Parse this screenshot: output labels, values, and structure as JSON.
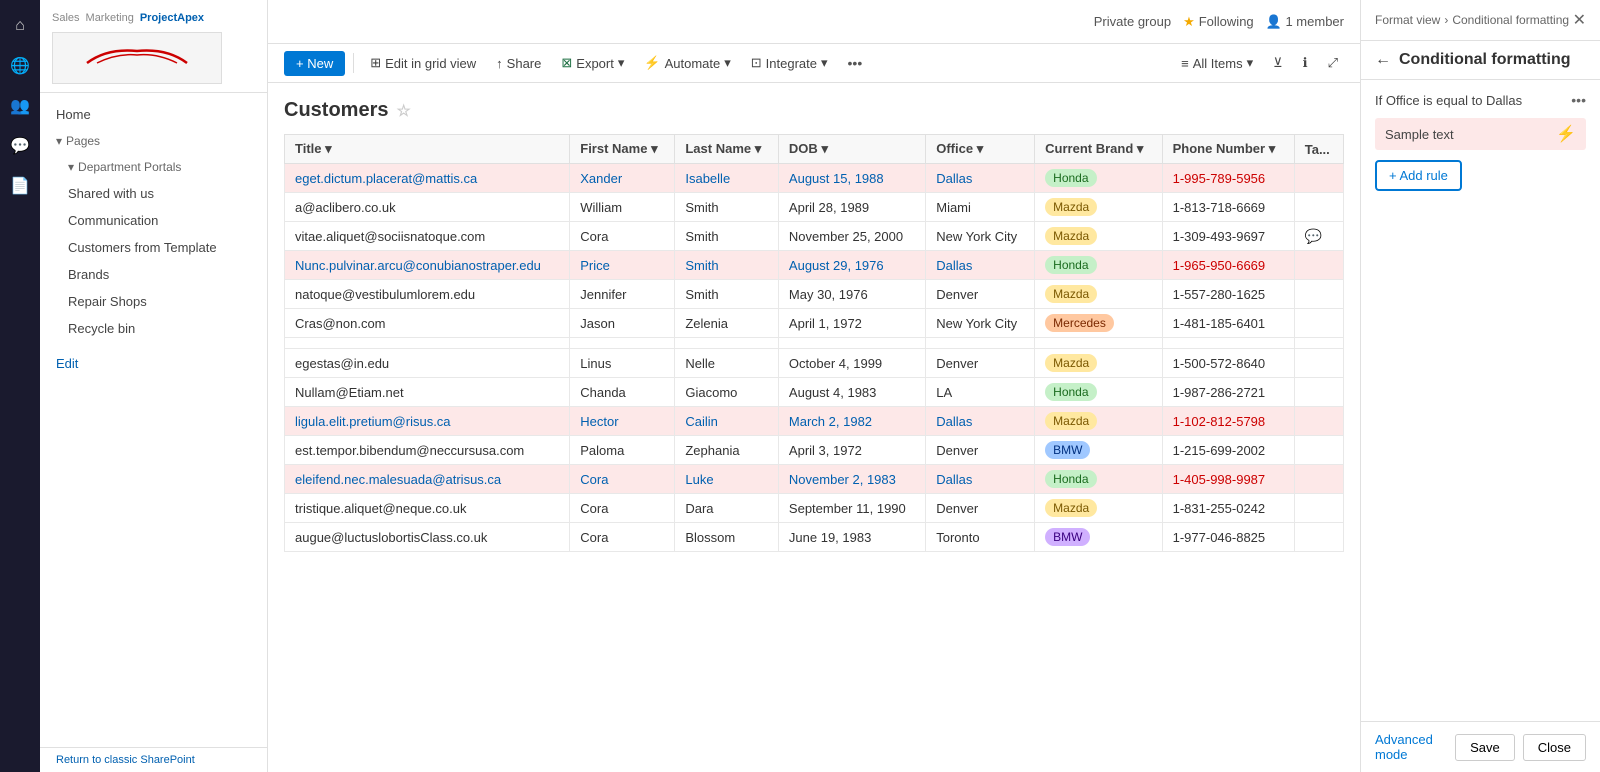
{
  "app": {
    "title": "ProjectApex",
    "nav_tabs": [
      "Sales",
      "Marketing",
      "ProjectApex"
    ]
  },
  "sidebar_icons": [
    {
      "name": "home-icon",
      "symbol": "⌂"
    },
    {
      "name": "globe-icon",
      "symbol": "🌐"
    },
    {
      "name": "people-icon",
      "symbol": "👥"
    },
    {
      "name": "chat-icon",
      "symbol": "💬"
    },
    {
      "name": "document-icon",
      "symbol": "📄"
    }
  ],
  "nav": {
    "home_label": "Home",
    "pages_label": "Pages",
    "department_portals_label": "Department Portals",
    "items": [
      {
        "label": "Shared with us",
        "id": "shared"
      },
      {
        "label": "Communication",
        "id": "communication"
      },
      {
        "label": "Customers from Template",
        "id": "customers-template"
      },
      {
        "label": "Brands",
        "id": "brands"
      },
      {
        "label": "Repair Shops",
        "id": "repair-shops"
      },
      {
        "label": "Recycle bin",
        "id": "recycle-bin"
      }
    ],
    "edit_label": "Edit",
    "return_label": "Return to classic SharePoint"
  },
  "top_bar": {
    "private_group_label": "Private group",
    "following_label": "Following",
    "member_label": "1 member"
  },
  "toolbar": {
    "new_label": "+ New",
    "edit_grid_label": "Edit in grid view",
    "share_label": "Share",
    "export_label": "Export",
    "automate_label": "Automate",
    "integrate_label": "Integrate",
    "all_items_label": "All Items"
  },
  "table": {
    "title": "Customers",
    "columns": [
      "Title",
      "First Name",
      "Last Name",
      "DOB",
      "Office",
      "Current Brand",
      "Phone Number",
      "Ta..."
    ],
    "rows": [
      {
        "title": "eget.dictum.placerat@mattis.ca",
        "first_name": "Xander",
        "last_name": "Isabelle",
        "dob": "August 15, 1988",
        "office": "Dallas",
        "brand": "Honda",
        "brand_class": "brand-honda",
        "phone": "1-995-789-5956",
        "highlight": true,
        "chat": false
      },
      {
        "title": "a@aclibero.co.uk",
        "first_name": "William",
        "last_name": "Smith",
        "dob": "April 28, 1989",
        "office": "Miami",
        "brand": "Mazda",
        "brand_class": "brand-mazda",
        "phone": "1-813-718-6669",
        "highlight": false,
        "chat": false
      },
      {
        "title": "vitae.aliquet@sociisnatoque.com",
        "first_name": "Cora",
        "last_name": "Smith",
        "dob": "November 25, 2000",
        "office": "New York City",
        "brand": "Mazda",
        "brand_class": "brand-mazda",
        "phone": "1-309-493-9697",
        "highlight": false,
        "chat": true
      },
      {
        "title": "Nunc.pulvinar.arcu@conubianostraper.edu",
        "first_name": "Price",
        "last_name": "Smith",
        "dob": "August 29, 1976",
        "office": "Dallas",
        "brand": "Honda",
        "brand_class": "brand-honda",
        "phone": "1-965-950-6669",
        "highlight": true,
        "chat": false
      },
      {
        "title": "natoque@vestibulumlorem.edu",
        "first_name": "Jennifer",
        "last_name": "Smith",
        "dob": "May 30, 1976",
        "office": "Denver",
        "brand": "Mazda",
        "brand_class": "brand-mazda",
        "phone": "1-557-280-1625",
        "highlight": false,
        "chat": false
      },
      {
        "title": "Cras@non.com",
        "first_name": "Jason",
        "last_name": "Zelenia",
        "dob": "April 1, 1972",
        "office": "New York City",
        "brand": "Mercedes",
        "brand_class": "brand-mercedes",
        "phone": "1-481-185-6401",
        "highlight": false,
        "chat": false
      },
      {
        "title": "",
        "first_name": "",
        "last_name": "",
        "dob": "",
        "office": "",
        "brand": "",
        "brand_class": "",
        "phone": "",
        "highlight": false,
        "chat": false
      },
      {
        "title": "egestas@in.edu",
        "first_name": "Linus",
        "last_name": "Nelle",
        "dob": "October 4, 1999",
        "office": "Denver",
        "brand": "Mazda",
        "brand_class": "brand-mazda",
        "phone": "1-500-572-8640",
        "highlight": false,
        "chat": false
      },
      {
        "title": "Nullam@Etiam.net",
        "first_name": "Chanda",
        "last_name": "Giacomo",
        "dob": "August 4, 1983",
        "office": "LA",
        "brand": "Honda",
        "brand_class": "brand-honda",
        "phone": "1-987-286-2721",
        "highlight": false,
        "chat": false
      },
      {
        "title": "ligula.elit.pretium@risus.ca",
        "first_name": "Hector",
        "last_name": "Cailin",
        "dob": "March 2, 1982",
        "office": "Dallas",
        "brand": "Mazda",
        "brand_class": "brand-mazda",
        "phone": "1-102-812-5798",
        "highlight": true,
        "chat": false
      },
      {
        "title": "est.tempor.bibendum@neccursusa.com",
        "first_name": "Paloma",
        "last_name": "Zephania",
        "dob": "April 3, 1972",
        "office": "Denver",
        "brand": "BMW",
        "brand_class": "brand-bmw",
        "phone": "1-215-699-2002",
        "highlight": false,
        "chat": false
      },
      {
        "title": "eleifend.nec.malesuada@atrisus.ca",
        "first_name": "Cora",
        "last_name": "Luke",
        "dob": "November 2, 1983",
        "office": "Dallas",
        "brand": "Honda",
        "brand_class": "brand-honda",
        "phone": "1-405-998-9987",
        "highlight": true,
        "chat": false
      },
      {
        "title": "tristique.aliquet@neque.co.uk",
        "first_name": "Cora",
        "last_name": "Dara",
        "dob": "September 11, 1990",
        "office": "Denver",
        "brand": "Mazda",
        "brand_class": "brand-mazda",
        "phone": "1-831-255-0242",
        "highlight": false,
        "chat": false
      },
      {
        "title": "augue@luctuslobortisClass.co.uk",
        "first_name": "Cora",
        "last_name": "Blossom",
        "dob": "June 19, 1983",
        "office": "Toronto",
        "brand": "BMW",
        "brand_class": "brand-bmw2",
        "phone": "1-977-046-8825",
        "highlight": false,
        "chat": false
      }
    ]
  },
  "right_panel": {
    "breadcrumb_format": "Format view",
    "breadcrumb_sep": ">",
    "breadcrumb_current": "Conditional formatting",
    "title": "Conditional formatting",
    "condition_label": "If Office is equal to Dallas",
    "sample_text": "Sample text",
    "add_rule_label": "+ Add rule",
    "advanced_mode_label": "Advanced mode",
    "save_label": "Save",
    "close_label": "Close"
  }
}
